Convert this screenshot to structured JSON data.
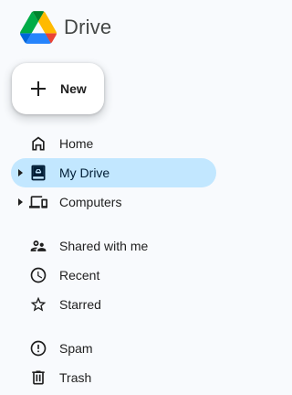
{
  "app": {
    "brand": "Drive"
  },
  "new_button": {
    "label": "New"
  },
  "nav": {
    "home": "Home",
    "my_drive": "My Drive",
    "computers": "Computers",
    "shared_with_me": "Shared with me",
    "recent": "Recent",
    "starred": "Starred",
    "spam": "Spam",
    "trash": "Trash"
  },
  "colors": {
    "selected_bg": "#c2e7ff",
    "background": "#f8fafd",
    "logo_green": "#0f9d58",
    "logo_blue": "#2684fc",
    "logo_yellow": "#ffba00"
  },
  "selected_item": "my_drive"
}
